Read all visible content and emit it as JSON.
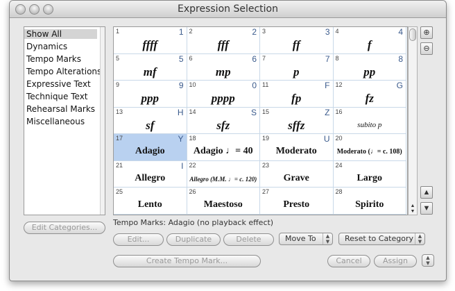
{
  "window": {
    "title": "Expression Selection"
  },
  "sidebar": {
    "items": [
      {
        "label": "Show All",
        "selected": true
      },
      {
        "label": "Dynamics"
      },
      {
        "label": "Tempo Marks"
      },
      {
        "label": "Tempo Alterations"
      },
      {
        "label": "Expressive Text"
      },
      {
        "label": "Technique Text"
      },
      {
        "label": "Rehearsal Marks"
      },
      {
        "label": "Miscellaneous"
      }
    ]
  },
  "grid": {
    "cells": [
      {
        "num": "1",
        "key": "1",
        "sym": "ffff"
      },
      {
        "num": "2",
        "key": "2",
        "sym": "fff"
      },
      {
        "num": "3",
        "key": "3",
        "sym": "ff"
      },
      {
        "num": "4",
        "key": "4",
        "sym": "f"
      },
      {
        "num": "5",
        "key": "5",
        "sym": "mf"
      },
      {
        "num": "6",
        "key": "6",
        "sym": "mp"
      },
      {
        "num": "7",
        "key": "7",
        "sym": "p"
      },
      {
        "num": "8",
        "key": "8",
        "sym": "pp"
      },
      {
        "num": "9",
        "key": "9",
        "sym": "ppp"
      },
      {
        "num": "10",
        "key": "0",
        "sym": "pppp"
      },
      {
        "num": "11",
        "key": "F",
        "sym": "fp"
      },
      {
        "num": "12",
        "key": "G",
        "sym": "fz"
      },
      {
        "num": "13",
        "key": "H",
        "sym": "sf"
      },
      {
        "num": "14",
        "key": "S",
        "sym": "sfz"
      },
      {
        "num": "15",
        "key": "Z",
        "sym": "sffz"
      },
      {
        "num": "16",
        "key": "",
        "sym": "subito p",
        "style": "subito"
      },
      {
        "num": "17",
        "key": "Y",
        "sym": "Adagio",
        "style": "tempo",
        "selected": true
      },
      {
        "num": "18",
        "key": "",
        "sym": "Adagio ♩= 40",
        "style": "tempo"
      },
      {
        "num": "19",
        "key": "U",
        "sym": "Moderato",
        "style": "tempo"
      },
      {
        "num": "20",
        "key": "",
        "sym": "Moderato (♩= c. 108)",
        "style": "mid"
      },
      {
        "num": "21",
        "key": "I",
        "sym": "Allegro",
        "style": "tempo"
      },
      {
        "num": "22",
        "key": "",
        "sym": "Allegro (M.M. ♩= c. 120)",
        "style": "small"
      },
      {
        "num": "23",
        "key": "",
        "sym": "Grave",
        "style": "tempo"
      },
      {
        "num": "24",
        "key": "",
        "sym": "Largo",
        "style": "tempo"
      },
      {
        "num": "25",
        "key": "",
        "sym": "Lento",
        "style": "tempo"
      },
      {
        "num": "26",
        "key": "",
        "sym": "Maestoso",
        "style": "tempo"
      },
      {
        "num": "27",
        "key": "",
        "sym": "Presto",
        "style": "tempo"
      },
      {
        "num": "28",
        "key": "",
        "sym": "Spirito",
        "style": "tempo"
      }
    ]
  },
  "zoom": {
    "in_icon": "zoom-in-icon",
    "out_icon": "zoom-out-icon"
  },
  "status": "Tempo Marks: Adagio (no playback effect)",
  "buttons": {
    "edit_categories": "Edit Categories...",
    "edit": "Edit...",
    "duplicate": "Duplicate",
    "delete": "Delete",
    "move_to": "Move To",
    "reset_to_category": "Reset to Category",
    "create_tempo_mark": "Create Tempo Mark...",
    "cancel": "Cancel",
    "assign": "Assign"
  }
}
